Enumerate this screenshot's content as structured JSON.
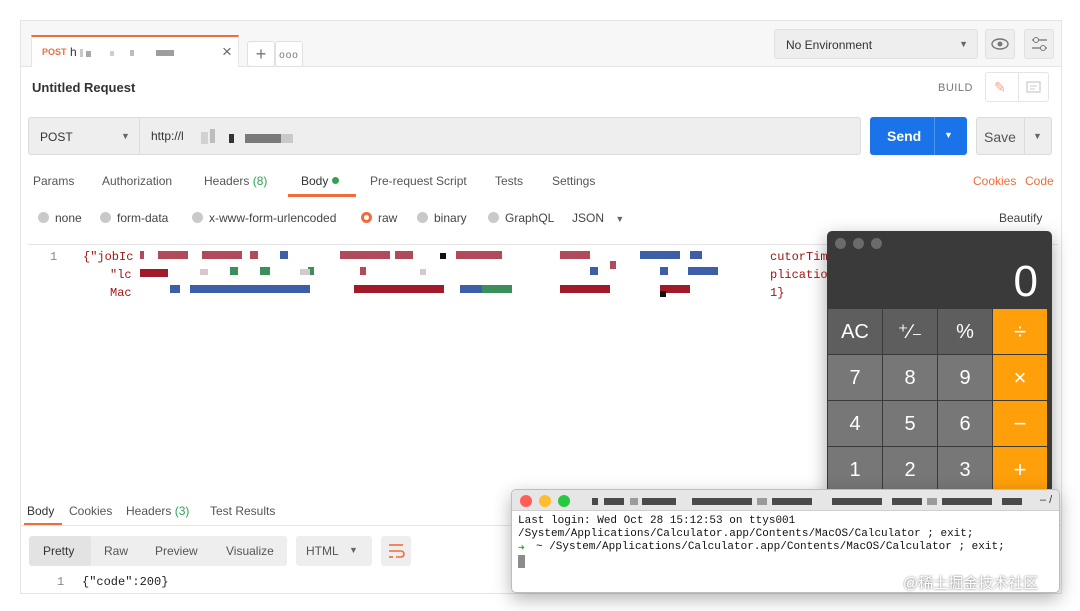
{
  "request_tab": {
    "method": "POST",
    "title": "h"
  },
  "env": {
    "label": "No Environment"
  },
  "request": {
    "title": "Untitled Request",
    "build": "BUILD",
    "method": "POST",
    "url": "http://l"
  },
  "buttons": {
    "send": "Send",
    "save": "Save",
    "cookies": "Cookies",
    "code": "Code",
    "beautify": "Beautify"
  },
  "req_tabs": {
    "params": "Params",
    "authorization": "Authorization",
    "headers": "Headers",
    "headers_count": "(8)",
    "body": "Body",
    "prerequest": "Pre-request Script",
    "tests": "Tests",
    "settings": "Settings"
  },
  "body_types": {
    "none": "none",
    "form_data": "form-data",
    "urlencoded": "x-www-form-urlencoded",
    "raw": "raw",
    "binary": "binary",
    "graphql": "GraphQL",
    "format": "JSON"
  },
  "editor": {
    "line_number": "1",
    "lines": [
      "{\"jobIc",
      "\"lc",
      "Mac"
    ],
    "right_lines": [
      "cutorTime",
      "plication",
      "1}"
    ]
  },
  "response": {
    "tabs": {
      "body": "Body",
      "cookies": "Cookies",
      "headers": "Headers",
      "headers_count": "(3)",
      "test_results": "Test Results"
    },
    "views": {
      "pretty": "Pretty",
      "raw": "Raw",
      "preview": "Preview",
      "visualize": "Visualize",
      "format": "HTML"
    },
    "line_number": "1",
    "content": "{\"code\":200}"
  },
  "calculator": {
    "display": "0",
    "keys": [
      [
        "AC",
        "⁺∕₋",
        "%",
        "÷"
      ],
      [
        "7",
        "8",
        "9",
        "×"
      ],
      [
        "4",
        "5",
        "6",
        "−"
      ],
      [
        "1",
        "2",
        "3",
        "+"
      ]
    ]
  },
  "terminal": {
    "title_suffix": "– /",
    "lines": [
      "Last login: Wed Oct 28 15:12:53 on ttys001",
      "/System/Applications/Calculator.app/Contents/MacOS/Calculator ; exit;",
      "~ /System/Applications/Calculator.app/Contents/MacOS/Calculator ; exit;"
    ],
    "prompt_arrow": "➜"
  },
  "watermark": "@稀土掘金技术社区",
  "colors": {
    "accent": "#f26b3a",
    "send_blue": "#1a73e8",
    "calc_orange": "#ff9f0a",
    "green": "#2ea44f"
  }
}
